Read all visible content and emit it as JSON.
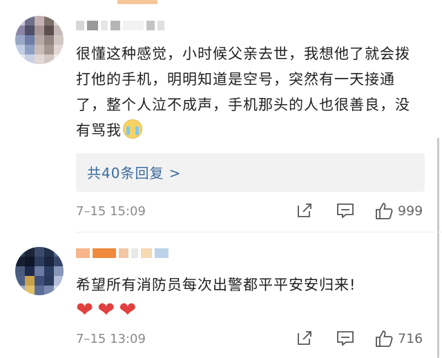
{
  "comments": [
    {
      "text_parts": [
        "很懂这种感觉，小时候父亲去世，我想他了就会拨打他的手机，明明知道是空号，突然有一天接通了，整个人泣不成声，手机那头的人也很善良，没有骂我"
      ],
      "emoji": "crying-face-icon",
      "replies_label": "共40条回复 >",
      "time": "7–15 15:09",
      "likes": "999"
    },
    {
      "text_parts": [
        "希望所有消防员每次出警都平平安安归来!"
      ],
      "hearts": [
        "❤",
        "❤",
        "❤"
      ],
      "time": "7–15 13:09",
      "likes": "716"
    }
  ],
  "colors": {
    "link": "#3a6a9c",
    "meta": "#8a8a8a",
    "reply_box": "#f2f2f2",
    "heart": "#e0413f"
  }
}
